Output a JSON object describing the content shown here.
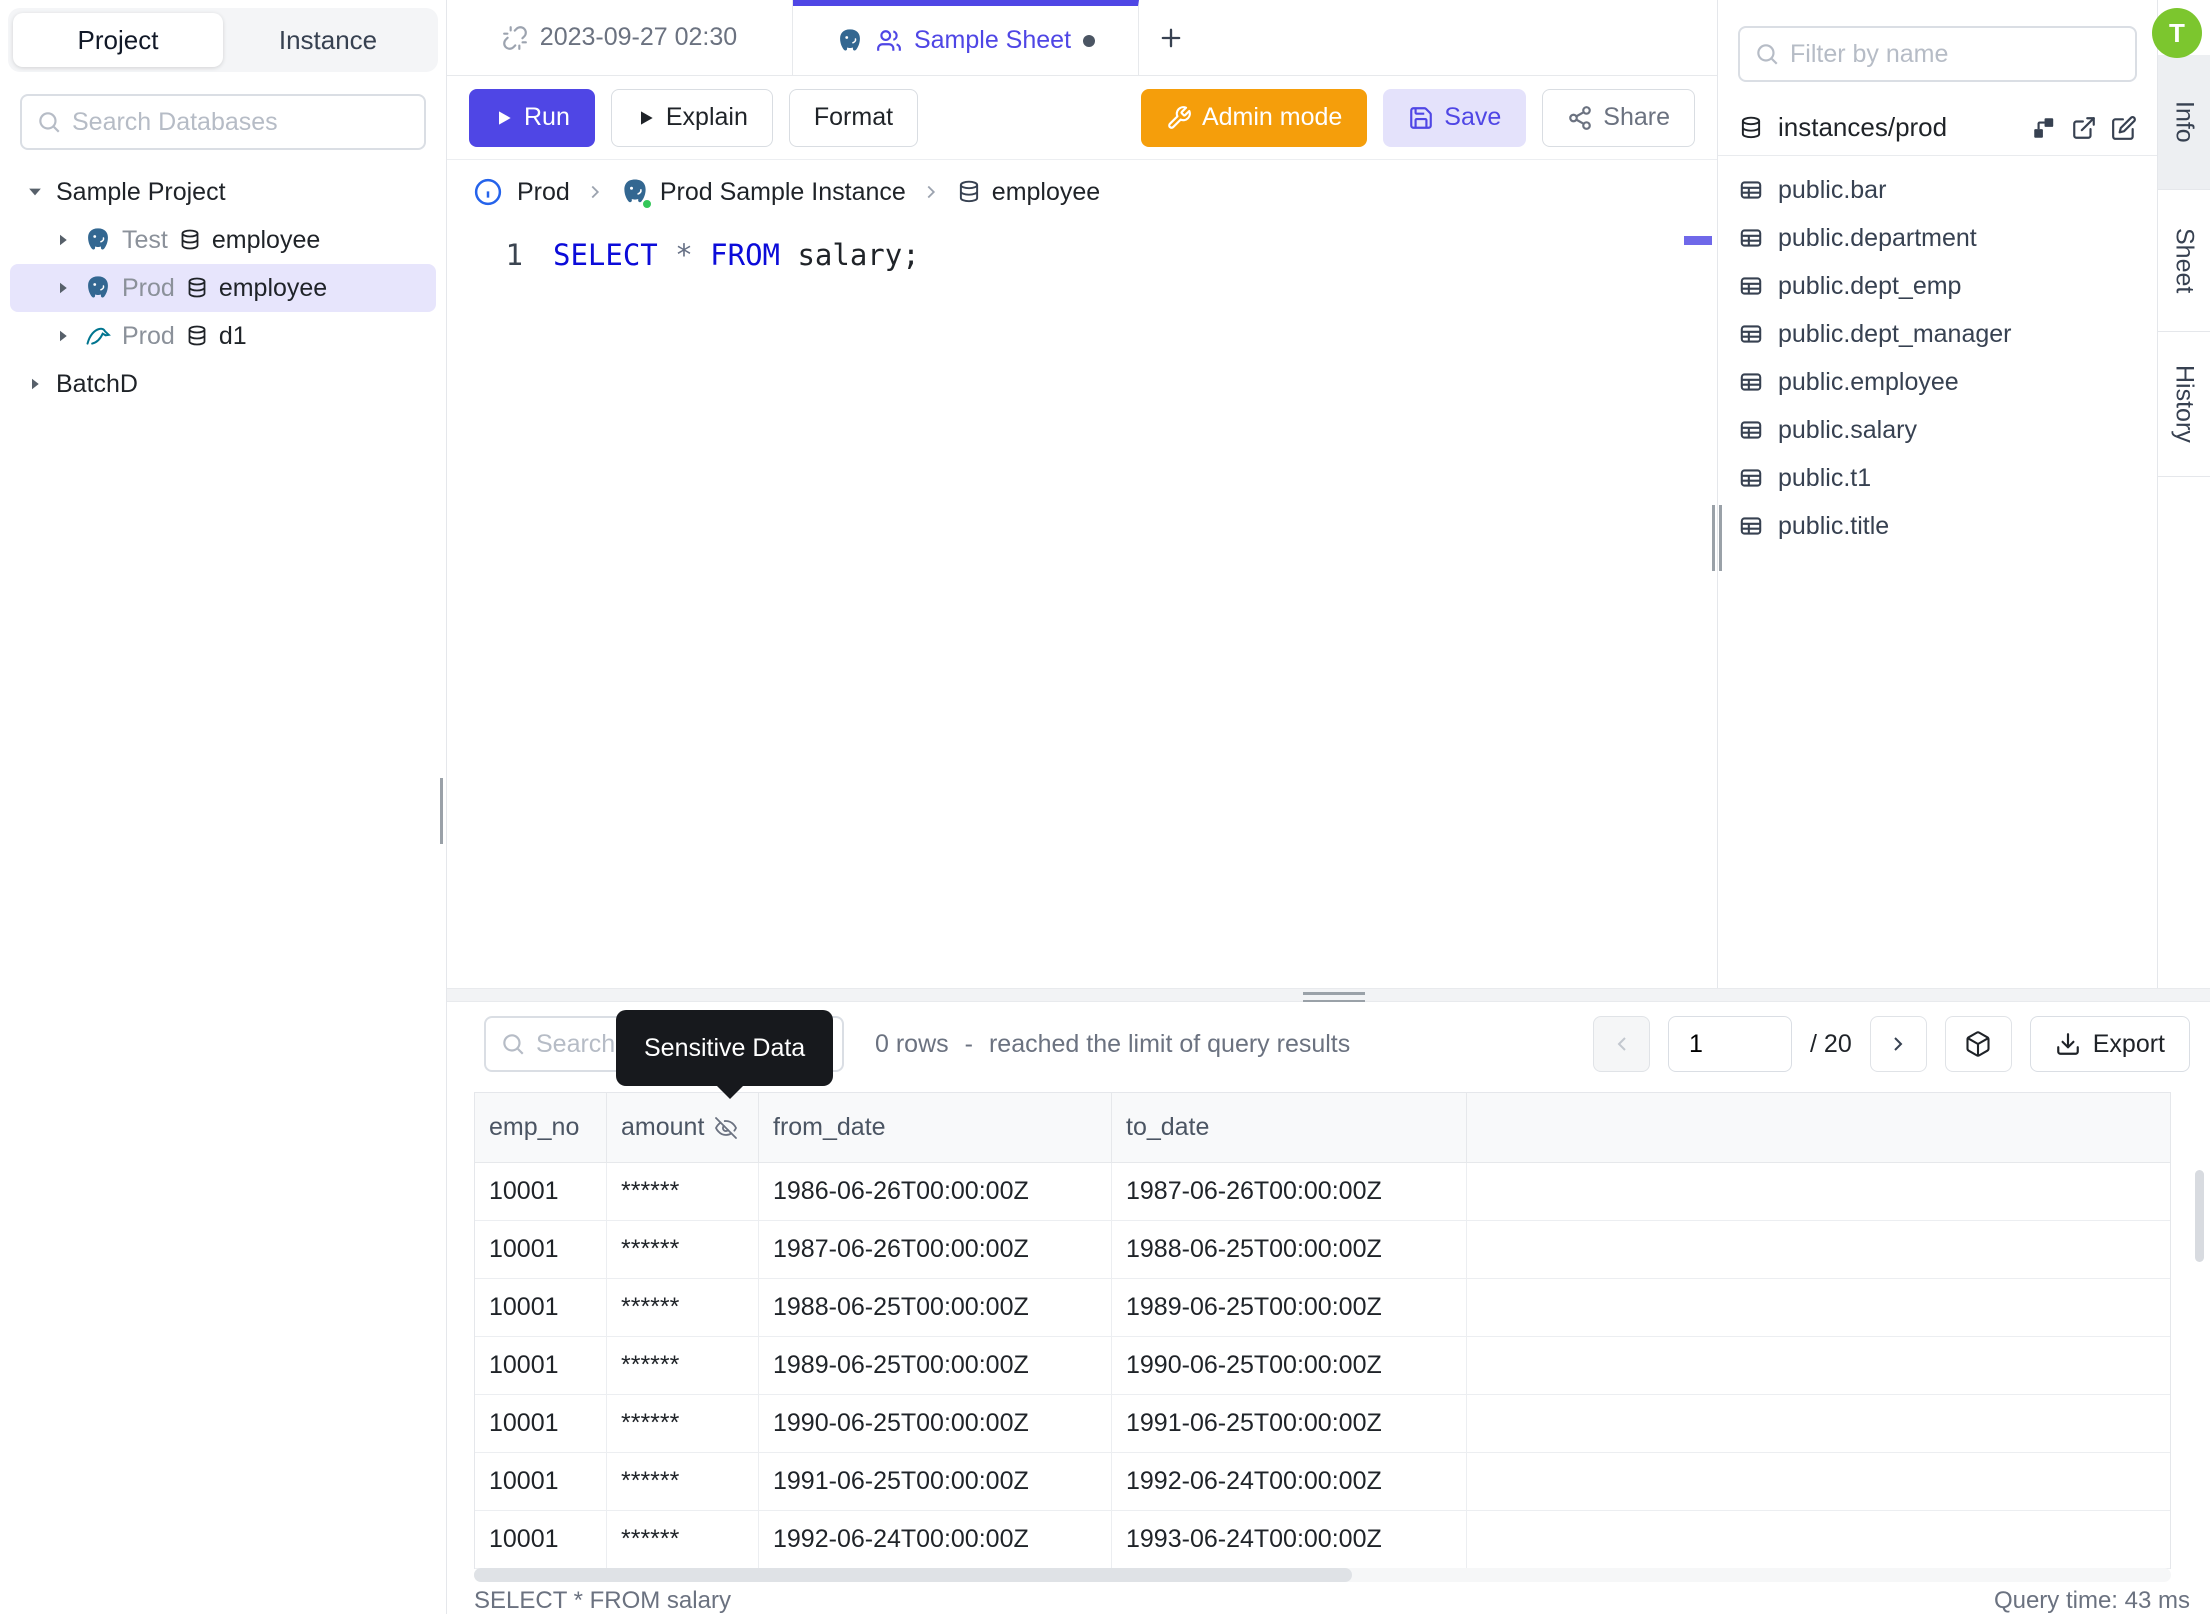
{
  "colors": {
    "accent": "#4f46e5",
    "admin_orange": "#f59e0b",
    "avatar_green": "#7cc62e",
    "keyword_blue": "#0b0bd9",
    "selected_row_bg": "#e7e5fc",
    "tooltip_bg": "#17191d"
  },
  "user": {
    "avatar_initial": "T"
  },
  "sidebar": {
    "tabs": [
      "Project",
      "Instance"
    ],
    "search_placeholder": "Search Databases",
    "tree": {
      "project": "Sample Project",
      "databases": [
        {
          "env": "Test",
          "name": "employee",
          "engine": "postgres"
        },
        {
          "env": "Prod",
          "name": "employee",
          "engine": "postgres"
        },
        {
          "env": "Prod",
          "name": "d1",
          "engine": "mysql"
        }
      ],
      "other_project": "BatchD"
    }
  },
  "tabbar": {
    "tabs": [
      {
        "label": "2023-09-27 02:30"
      },
      {
        "label": "Sample Sheet"
      }
    ],
    "add_label": "+"
  },
  "toolbar": {
    "run": "Run",
    "explain": "Explain",
    "format": "Format",
    "admin_mode": "Admin mode",
    "save": "Save",
    "share": "Share"
  },
  "breadcrumb": {
    "env": "Prod",
    "instance": "Prod Sample Instance",
    "database": "employee"
  },
  "editor": {
    "line_number": "1",
    "keyword1": "SELECT",
    "operator": " * ",
    "keyword2": "FROM",
    "rest": " salary;"
  },
  "right_panel": {
    "filter_placeholder": "Filter by name",
    "group": "instances/prod",
    "tables": [
      "public.bar",
      "public.department",
      "public.dept_emp",
      "public.dept_manager",
      "public.employee",
      "public.salary",
      "public.t1",
      "public.title"
    ]
  },
  "side_tabs": [
    "Info",
    "Sheet",
    "History"
  ],
  "results": {
    "search_placeholder": "Search",
    "tooltip": "Sensitive Data",
    "rows_count": "0 rows",
    "separator": "-",
    "limit_text": "reached the limit of query results",
    "page": "1",
    "page_total": "/ 20",
    "export_label": "Export",
    "columns": [
      "emp_no",
      "amount",
      "from_date",
      "to_date"
    ],
    "rows": [
      [
        "10001",
        "******",
        "1986-06-26T00:00:00Z",
        "1987-06-26T00:00:00Z"
      ],
      [
        "10001",
        "******",
        "1987-06-26T00:00:00Z",
        "1988-06-25T00:00:00Z"
      ],
      [
        "10001",
        "******",
        "1988-06-25T00:00:00Z",
        "1989-06-25T00:00:00Z"
      ],
      [
        "10001",
        "******",
        "1989-06-25T00:00:00Z",
        "1990-06-25T00:00:00Z"
      ],
      [
        "10001",
        "******",
        "1990-06-25T00:00:00Z",
        "1991-06-25T00:00:00Z"
      ],
      [
        "10001",
        "******",
        "1991-06-25T00:00:00Z",
        "1992-06-24T00:00:00Z"
      ],
      [
        "10001",
        "******",
        "1992-06-24T00:00:00Z",
        "1993-06-24T00:00:00Z"
      ]
    ],
    "status_query": "SELECT * FROM salary",
    "query_time": "Query time: 43 ms"
  }
}
